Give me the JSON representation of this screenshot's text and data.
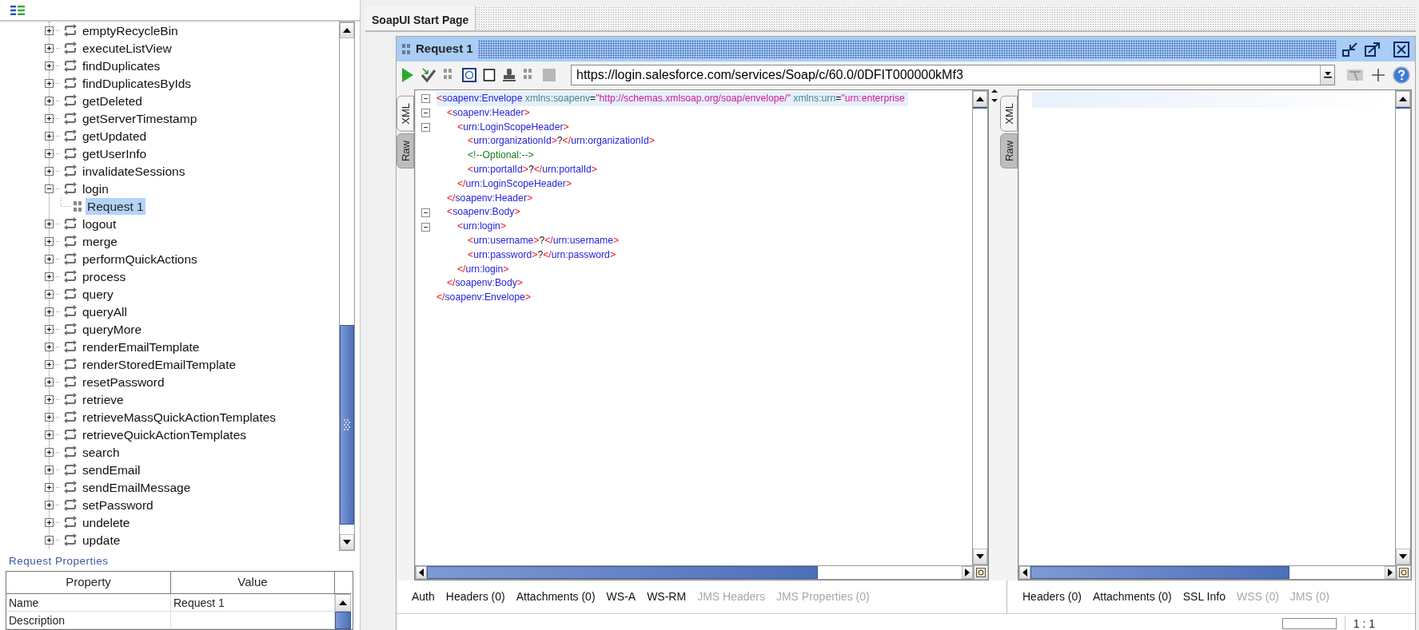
{
  "sidebar": {
    "tree": [
      {
        "label": "emptyRecycleBin",
        "expanded": false,
        "selected": false
      },
      {
        "label": "executeListView",
        "expanded": false,
        "selected": false
      },
      {
        "label": "findDuplicates",
        "expanded": false,
        "selected": false
      },
      {
        "label": "findDuplicatesByIds",
        "expanded": false,
        "selected": false
      },
      {
        "label": "getDeleted",
        "expanded": false,
        "selected": false
      },
      {
        "label": "getServerTimestamp",
        "expanded": false,
        "selected": false
      },
      {
        "label": "getUpdated",
        "expanded": false,
        "selected": false
      },
      {
        "label": "getUserInfo",
        "expanded": false,
        "selected": false
      },
      {
        "label": "invalidateSessions",
        "expanded": false,
        "selected": false
      },
      {
        "label": "login",
        "expanded": true,
        "selected": false,
        "children": [
          {
            "label": "Request 1",
            "kind": "request",
            "selected": true
          }
        ]
      },
      {
        "label": "logout",
        "expanded": false,
        "selected": false
      },
      {
        "label": "merge",
        "expanded": false,
        "selected": false
      },
      {
        "label": "performQuickActions",
        "expanded": false,
        "selected": false
      },
      {
        "label": "process",
        "expanded": false,
        "selected": false
      },
      {
        "label": "query",
        "expanded": false,
        "selected": false
      },
      {
        "label": "queryAll",
        "expanded": false,
        "selected": false
      },
      {
        "label": "queryMore",
        "expanded": false,
        "selected": false
      },
      {
        "label": "renderEmailTemplate",
        "expanded": false,
        "selected": false
      },
      {
        "label": "renderStoredEmailTemplate",
        "expanded": false,
        "selected": false
      },
      {
        "label": "resetPassword",
        "expanded": false,
        "selected": false
      },
      {
        "label": "retrieve",
        "expanded": false,
        "selected": false
      },
      {
        "label": "retrieveMassQuickActionTemplates",
        "expanded": false,
        "selected": false
      },
      {
        "label": "retrieveQuickActionTemplates",
        "expanded": false,
        "selected": false
      },
      {
        "label": "search",
        "expanded": false,
        "selected": false
      },
      {
        "label": "sendEmail",
        "expanded": false,
        "selected": false
      },
      {
        "label": "sendEmailMessage",
        "expanded": false,
        "selected": false
      },
      {
        "label": "setPassword",
        "expanded": false,
        "selected": false
      },
      {
        "label": "undelete",
        "expanded": false,
        "selected": false
      },
      {
        "label": "update",
        "expanded": false,
        "selected": false
      }
    ]
  },
  "properties": {
    "title": "Request Properties",
    "columns": [
      "Property",
      "Value"
    ],
    "rows": [
      {
        "property": "Name",
        "value": "Request 1"
      },
      {
        "property": "Description"
      }
    ]
  },
  "tabs": [
    {
      "label": "SoapUI Start Page",
      "selected": true
    }
  ],
  "request": {
    "title": "Request 1",
    "url": "https://login.salesforce.com/services/Soap/c/60.0/0DFIT000000kMf3",
    "editor_tabs": [
      {
        "label": "XML",
        "selected": true
      },
      {
        "label": "Raw",
        "selected": false
      }
    ],
    "xml": [
      {
        "fold": true,
        "highlighted": true,
        "tokens": [
          {
            "kind": "punct",
            "text": "<"
          },
          {
            "kind": "tag",
            "text": "soapenv:Envelope"
          },
          {
            "kind": "attr",
            "text": " xmlns:soapenv"
          },
          {
            "kind": "plain",
            "text": "="
          },
          {
            "kind": "value",
            "text": "\"http://schemas.xmlsoap.org/soap/envelope/\""
          },
          {
            "kind": "attr",
            "text": " xmlns:urn"
          },
          {
            "kind": "plain",
            "text": "="
          },
          {
            "kind": "value",
            "text": "\"urn:enterprise"
          }
        ],
        "children": [
          {
            "fold": true,
            "highlighted": false,
            "tokens": [
              {
                "kind": "punct",
                "text": "<"
              },
              {
                "kind": "tag",
                "text": "soapenv:Header"
              },
              {
                "kind": "punct",
                "text": ">"
              }
            ],
            "children": [
              {
                "fold": true,
                "highlighted": false,
                "tokens": [
                  {
                    "kind": "punct",
                    "text": "<"
                  },
                  {
                    "kind": "tag",
                    "text": "urn:LoginScopeHeader"
                  },
                  {
                    "kind": "punct",
                    "text": ">"
                  }
                ],
                "children": [
                  {
                    "fold": false,
                    "highlighted": false,
                    "tokens": [
                      {
                        "kind": "punct",
                        "text": "<"
                      },
                      {
                        "kind": "tag",
                        "text": "urn:organizationId"
                      },
                      {
                        "kind": "punct",
                        "text": ">"
                      },
                      {
                        "kind": "plain",
                        "text": "?"
                      },
                      {
                        "kind": "punct",
                        "text": "</"
                      },
                      {
                        "kind": "tag",
                        "text": "urn:organizationId"
                      },
                      {
                        "kind": "punct",
                        "text": ">"
                      }
                    ]
                  },
                  {
                    "fold": false,
                    "highlighted": false,
                    "tokens": [
                      {
                        "kind": "comment",
                        "text": "<!--Optional:-->"
                      }
                    ]
                  },
                  {
                    "fold": false,
                    "highlighted": false,
                    "tokens": [
                      {
                        "kind": "punct",
                        "text": "<"
                      },
                      {
                        "kind": "tag",
                        "text": "urn:portalId"
                      },
                      {
                        "kind": "punct",
                        "text": ">"
                      },
                      {
                        "kind": "plain",
                        "text": "?"
                      },
                      {
                        "kind": "punct",
                        "text": "</"
                      },
                      {
                        "kind": "tag",
                        "text": "urn:portalId"
                      },
                      {
                        "kind": "punct",
                        "text": ">"
                      }
                    ]
                  }
                ],
                "end": [
                  {
                    "kind": "punct",
                    "text": "</"
                  },
                  {
                    "kind": "tag",
                    "text": "urn:LoginScopeHeader"
                  },
                  {
                    "kind": "punct",
                    "text": ">"
                  }
                ]
              }
            ],
            "end": [
              {
                "kind": "punct",
                "text": "</"
              },
              {
                "kind": "tag",
                "text": "soapenv:Header"
              },
              {
                "kind": "punct",
                "text": ">"
              }
            ]
          },
          {
            "fold": true,
            "highlighted": false,
            "tokens": [
              {
                "kind": "punct",
                "text": "<"
              },
              {
                "kind": "tag",
                "text": "soapenv:Body"
              },
              {
                "kind": "punct",
                "text": ">"
              }
            ],
            "children": [
              {
                "fold": true,
                "highlighted": false,
                "tokens": [
                  {
                    "kind": "punct",
                    "text": "<"
                  },
                  {
                    "kind": "tag",
                    "text": "urn:login"
                  },
                  {
                    "kind": "punct",
                    "text": ">"
                  }
                ],
                "children": [
                  {
                    "fold": false,
                    "highlighted": false,
                    "tokens": [
                      {
                        "kind": "punct",
                        "text": "<"
                      },
                      {
                        "kind": "tag",
                        "text": "urn:username"
                      },
                      {
                        "kind": "punct",
                        "text": ">"
                      },
                      {
                        "kind": "plain",
                        "text": "?"
                      },
                      {
                        "kind": "punct",
                        "text": "</"
                      },
                      {
                        "kind": "tag",
                        "text": "urn:username"
                      },
                      {
                        "kind": "punct",
                        "text": ">"
                      }
                    ]
                  },
                  {
                    "fold": false,
                    "highlighted": false,
                    "tokens": [
                      {
                        "kind": "punct",
                        "text": "<"
                      },
                      {
                        "kind": "tag",
                        "text": "urn:password"
                      },
                      {
                        "kind": "punct",
                        "text": ">"
                      },
                      {
                        "kind": "plain",
                        "text": "?"
                      },
                      {
                        "kind": "punct",
                        "text": "</"
                      },
                      {
                        "kind": "tag",
                        "text": "urn:password"
                      },
                      {
                        "kind": "punct",
                        "text": ">"
                      }
                    ]
                  }
                ],
                "end": [
                  {
                    "kind": "punct",
                    "text": "</"
                  },
                  {
                    "kind": "tag",
                    "text": "urn:login"
                  },
                  {
                    "kind": "punct",
                    "text": ">"
                  }
                ]
              }
            ],
            "end": [
              {
                "kind": "punct",
                "text": "</"
              },
              {
                "kind": "tag",
                "text": "soapenv:Body"
              },
              {
                "kind": "punct",
                "text": ">"
              }
            ]
          }
        ],
        "end": [
          {
            "kind": "punct",
            "text": "</"
          },
          {
            "kind": "tag",
            "text": "soapenv:Envelope"
          },
          {
            "kind": "punct",
            "text": ">"
          }
        ]
      }
    ],
    "bottom_tabs": [
      {
        "label": "Auth",
        "disabled": false
      },
      {
        "label": "Headers (0)",
        "disabled": false
      },
      {
        "label": "Attachments (0)",
        "disabled": false
      },
      {
        "label": "WS-A",
        "disabled": false
      },
      {
        "label": "WS-RM",
        "disabled": false
      },
      {
        "label": "JMS Headers",
        "disabled": true
      },
      {
        "label": "JMS Properties (0)",
        "disabled": true
      }
    ]
  },
  "response": {
    "editor_tabs": [
      {
        "label": "XML",
        "selected": true
      },
      {
        "label": "Raw",
        "selected": false
      }
    ],
    "first_line_highlighted": true,
    "bottom_tabs": [
      {
        "label": "Headers (0)",
        "disabled": false
      },
      {
        "label": "Attachments (0)",
        "disabled": false
      },
      {
        "label": "SSL Info",
        "disabled": false
      },
      {
        "label": "WSS (0)",
        "disabled": true
      },
      {
        "label": "JMS (0)",
        "disabled": true
      }
    ]
  },
  "status_bar": {
    "progress": {
      "level": 0
    },
    "position": "1 : 1"
  }
}
